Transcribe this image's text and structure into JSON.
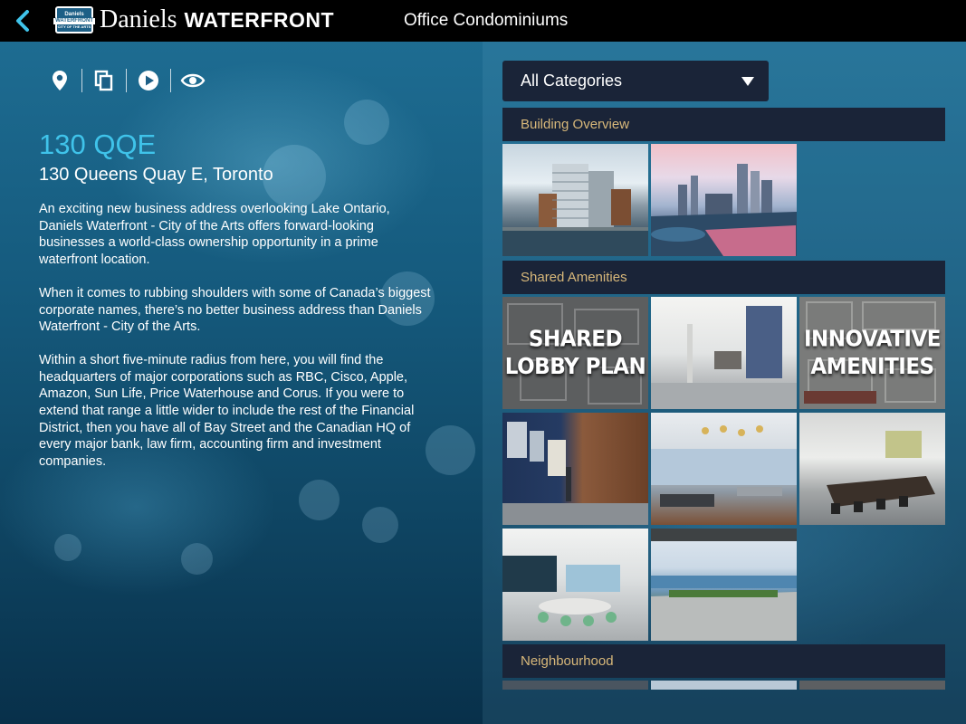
{
  "header": {
    "back_icon": "chevron-left-icon",
    "logo_badge": {
      "top": "Daniels",
      "mid": "WATERFRONT",
      "bottom": "CITY OF THE ARTS"
    },
    "brand_name": "Daniels",
    "brand_suffix": "WATERFRONT",
    "page_title": "Office Condominiums"
  },
  "toolbar": {
    "icons": [
      "location-pin-icon",
      "copy-icon",
      "play-icon",
      "eye-icon"
    ]
  },
  "building": {
    "name": "130 QQE",
    "address": "130 Queens Quay E, Toronto",
    "paragraphs": [
      "An exciting new business address overlooking Lake Ontario, Daniels Waterfront - City of the Arts offers forward-looking businesses a world-class ownership opportunity in a prime waterfront location.",
      "When it comes to rubbing shoulders with some of Canada’s biggest corporate names, there’s no better business address than Daniels Waterfront - City of the Arts.",
      "Within a short five-minute radius from here, you will find the headquarters of major corporations such as RBC, Cisco, Apple, Amazon, Sun Life, Price Waterhouse and Corus. If you were to extend that range a little wider to include the rest of the Financial District, then you have all of Bay Street and the Canadian HQ of every major bank, law firm, accounting firm and investment companies."
    ]
  },
  "category_filter": {
    "selected": "All Categories"
  },
  "gallery": {
    "sections": [
      {
        "title": "Building Overview"
      },
      {
        "title": "Shared Amenities"
      },
      {
        "title": "Neighbourhood"
      }
    ],
    "tile_labels": {
      "shared_lobby": "SHARED LOBBY PLAN",
      "innovative": "INNOVATIVE AMENITIES"
    }
  },
  "colors": {
    "accent": "#3fc3ea",
    "section_header_text": "#d8b87a",
    "panel_dark": "#1a2438",
    "top_bar": "#000000"
  }
}
